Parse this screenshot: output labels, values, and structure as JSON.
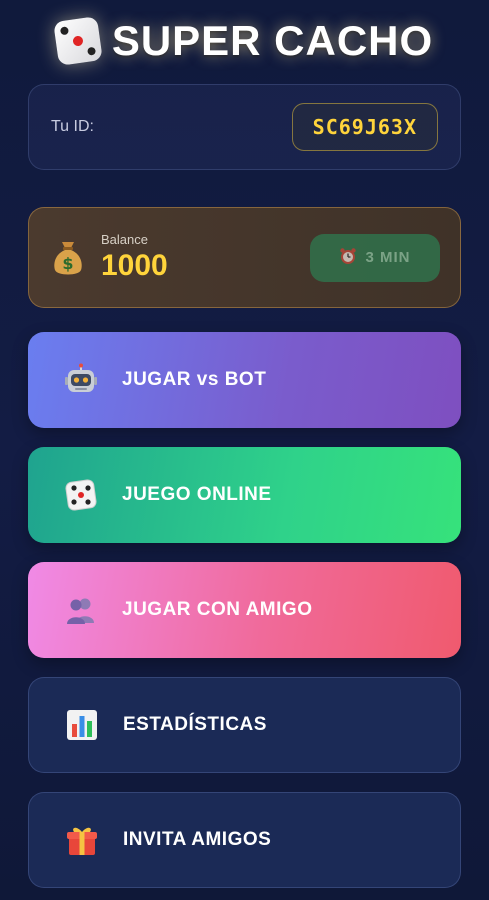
{
  "header": {
    "title": "SUPER CACHO",
    "logo_icon": "dice-icon"
  },
  "user": {
    "id_label": "Tu ID:",
    "id_value": "SC69J63X"
  },
  "balance": {
    "label": "Balance",
    "value": "1000",
    "icon": "money-bag-icon"
  },
  "timer": {
    "label": "3 MIN",
    "icon": "alarm-clock-icon"
  },
  "menu": [
    {
      "label": "JUGAR vs BOT",
      "icon": "robot-icon"
    },
    {
      "label": "JUEGO ONLINE",
      "icon": "dice-icon"
    },
    {
      "label": "JUGAR CON AMIGO",
      "icon": "people-icon"
    },
    {
      "label": "ESTADÍSTICAS",
      "icon": "bar-chart-icon"
    },
    {
      "label": "INVITA AMIGOS",
      "icon": "gift-icon"
    }
  ],
  "colors": {
    "background": "#121b40",
    "accent_gold": "#ffd43b",
    "bot_gradient": [
      "#6a7ef0",
      "#7e4fc0"
    ],
    "online_gradient": [
      "#1fa38f",
      "#36e27b"
    ],
    "amigo_gradient": [
      "#f08ae6",
      "#f05a6e"
    ],
    "secondary_button": "#1b2a56"
  }
}
